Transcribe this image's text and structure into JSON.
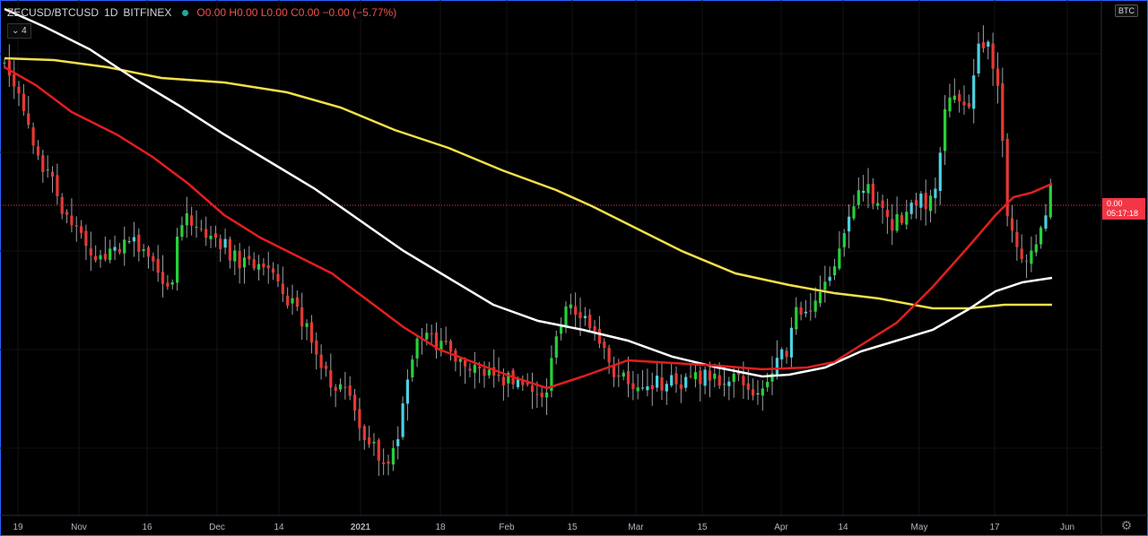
{
  "legend": {
    "symbol": "ZECUSD/BTCUSD",
    "interval": "1D",
    "exchange": "BITFINEX",
    "ohlc": "O0.00 H0.00 L0.00 C0.00 −0.00 (−5.77%)"
  },
  "indicator_badge": "4",
  "currency_label": "BTC",
  "price_tag": {
    "price": "0.00",
    "countdown": "05:17:18"
  },
  "colors": {
    "up": "#26d13a",
    "down": "#e53935",
    "up_hollow": "#4dd0e1",
    "ma_fast": "#e41e1e",
    "ma_mid": "#ffffff",
    "ma_slow": "#f3e04a",
    "border": "#2962ff"
  },
  "chart_data": {
    "type": "candlestick",
    "x_ticks": [
      "19",
      "Nov",
      "16",
      "Dec",
      "14",
      "2021",
      "18",
      "Feb",
      "15",
      "Mar",
      "15",
      "Apr",
      "14",
      "May",
      "17",
      "Jun"
    ],
    "x_range": [
      "2020-10-19",
      "2021-05-30"
    ],
    "series": [
      {
        "key": "candles",
        "trend": [
          100,
          80,
          72,
          70,
          74,
          66,
          60,
          58,
          40,
          52,
          48,
          44,
          47,
          50,
          62,
          45,
          40,
          36,
          38,
          37,
          38,
          36,
          34,
          40,
          70,
          68,
          72,
          80,
          90,
          70,
          65
        ]
      }
    ]
  }
}
